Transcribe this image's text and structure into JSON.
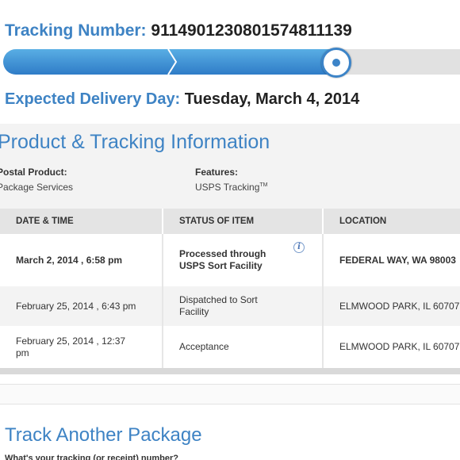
{
  "header": {
    "tracking_label": "Tracking Number:",
    "tracking_number": "9114901230801574811139",
    "delivery_label": "Expected Delivery Day:",
    "delivery_value": "Tuesday, March 4, 2014"
  },
  "progress": {
    "completed_fraction": 0.72,
    "fill_color": "#3e83c4",
    "track_color": "#e1e1e1"
  },
  "product_section": {
    "title": "Product & Tracking Information",
    "postal_product_label": "Postal Product:",
    "postal_product_value": "Package Services",
    "features_label": "Features:",
    "features_value": "USPS Tracking",
    "features_mark": "TM"
  },
  "table": {
    "headers": [
      "DATE & TIME",
      "STATUS OF ITEM",
      "LOCATION"
    ],
    "rows": [
      {
        "datetime": "March 2, 2014 , 6:58 pm",
        "status": "Processed through USPS Sort Facility",
        "location": "FEDERAL WAY, WA 98003"
      },
      {
        "datetime": "February 25, 2014 , 6:43 pm",
        "status": "Dispatched to Sort Facility",
        "location": "ELMWOOD PARK, IL 60707"
      },
      {
        "datetime": "February 25, 2014 , 12:37 pm",
        "status": "Acceptance",
        "location": "ELMWOOD PARK, IL 60707"
      }
    ],
    "info_icon": "info-icon"
  },
  "track_another": {
    "title": "Track Another Package",
    "question": "What's your tracking (or receipt) number?"
  },
  "colors": {
    "accent": "#3e83c4",
    "text": "#333333",
    "panel": "#f3f3f3"
  }
}
